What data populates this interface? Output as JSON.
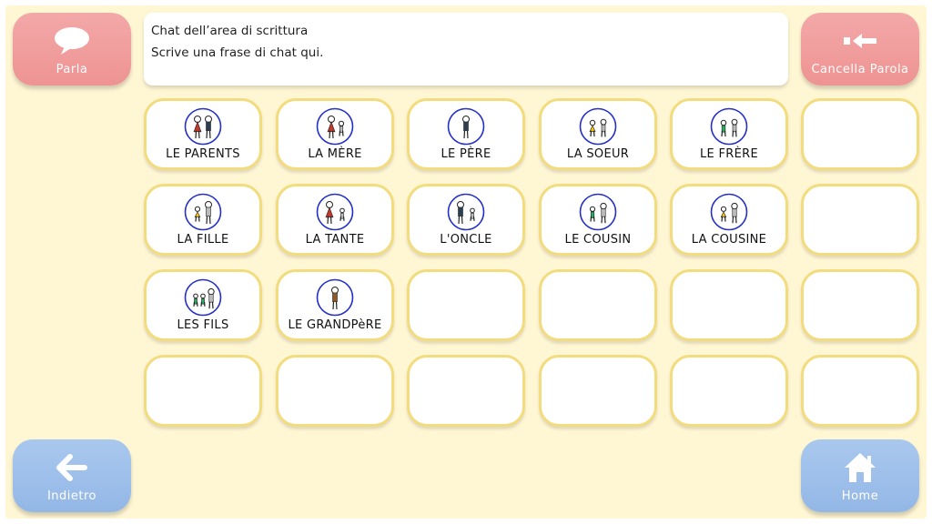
{
  "chat": {
    "line1": "Chat dell’area di scrittura",
    "line2": "Scrive una frase di chat qui."
  },
  "buttons": {
    "parla": {
      "label": "Parla",
      "icon": "speech-bubble-icon"
    },
    "cancella": {
      "label": "Cancella Parola",
      "icon": "backspace-arrow-icon"
    },
    "indietro": {
      "label": "Indietro",
      "icon": "left-arrow-icon"
    },
    "home": {
      "label": "Home",
      "icon": "house-icon"
    }
  },
  "colors": {
    "background": "#fff7d4",
    "tile_border": "#f3dc7e",
    "pink_button": "#ee9393",
    "blue_button": "#93b7e6"
  },
  "tiles": [
    {
      "label": "LE PARENTS",
      "icon": "parents-symbol-icon"
    },
    {
      "label": "LA MÈRE",
      "icon": "mother-symbol-icon"
    },
    {
      "label": "LE PÈRE",
      "icon": "father-symbol-icon"
    },
    {
      "label": "LA SOEUR",
      "icon": "sister-symbol-icon"
    },
    {
      "label": "LE FRÈRE",
      "icon": "brother-symbol-icon"
    },
    {
      "label": "",
      "icon": ""
    },
    {
      "label": "LA FILLE",
      "icon": "daughter-symbol-icon"
    },
    {
      "label": "LA TANTE",
      "icon": "aunt-symbol-icon"
    },
    {
      "label": "L'ONCLE",
      "icon": "uncle-symbol-icon"
    },
    {
      "label": "LE COUSIN",
      "icon": "cousin-male-symbol-icon"
    },
    {
      "label": "LA COUSINE",
      "icon": "cousin-female-symbol-icon"
    },
    {
      "label": "",
      "icon": ""
    },
    {
      "label": "LES FILS",
      "icon": "sons-symbol-icon"
    },
    {
      "label": "LE GRANDPèRE",
      "icon": "grandfather-symbol-icon"
    },
    {
      "label": "",
      "icon": ""
    },
    {
      "label": "",
      "icon": ""
    },
    {
      "label": "",
      "icon": ""
    },
    {
      "label": "",
      "icon": ""
    },
    {
      "label": "",
      "icon": ""
    },
    {
      "label": "",
      "icon": ""
    },
    {
      "label": "",
      "icon": ""
    },
    {
      "label": "",
      "icon": ""
    },
    {
      "label": "",
      "icon": ""
    },
    {
      "label": "",
      "icon": ""
    }
  ]
}
